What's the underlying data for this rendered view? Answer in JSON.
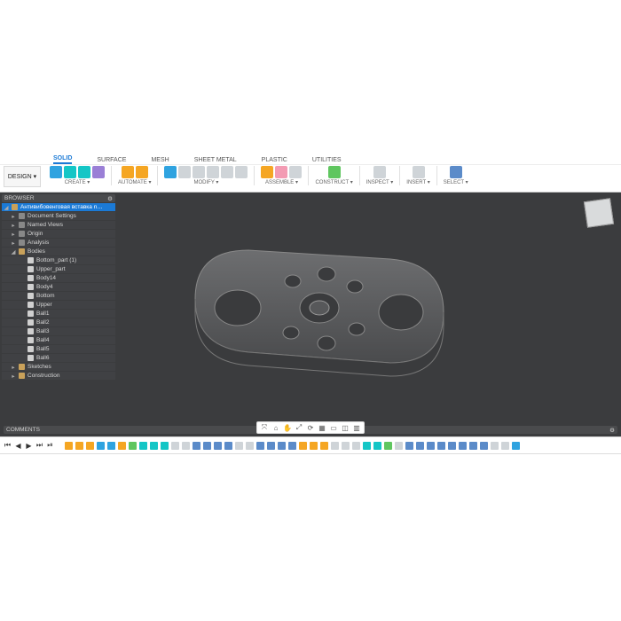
{
  "design_button": "DESIGN ▾",
  "tabs": [
    "SOLID",
    "SURFACE",
    "MESH",
    "SHEET METAL",
    "PLASTIC",
    "UTILITIES"
  ],
  "active_tab": "SOLID",
  "ribbon_groups": [
    {
      "label": "CREATE ▾",
      "icons": [
        "c-blue",
        "c-teal",
        "c-teal",
        "c-purp"
      ]
    },
    {
      "label": "AUTOMATE ▾",
      "icons": [
        "c-orange",
        "c-orange"
      ]
    },
    {
      "label": "MODIFY ▾",
      "icons": [
        "c-blue",
        "c-grey",
        "c-grey",
        "c-grey",
        "c-grey",
        "c-grey"
      ]
    },
    {
      "label": "ASSEMBLE ▾",
      "icons": [
        "c-orange",
        "c-pink",
        "c-grey"
      ]
    },
    {
      "label": "CONSTRUCT ▾",
      "icons": [
        "c-green"
      ]
    },
    {
      "label": "INSPECT ▾",
      "icons": [
        "c-grey"
      ]
    },
    {
      "label": "INSERT ▾",
      "icons": [
        "c-grey"
      ]
    },
    {
      "label": "SELECT ▾",
      "icons": [
        "c-nav"
      ]
    }
  ],
  "browser_title": "BROWSER",
  "tree": [
    {
      "d": 0,
      "tw": "◢",
      "label": "Антивибовенговая вставка n…",
      "sel": true,
      "i": "ic"
    },
    {
      "d": 1,
      "tw": "▸",
      "label": "Document Settings",
      "i": "g"
    },
    {
      "d": 1,
      "tw": "▸",
      "label": "Named Views",
      "i": "g"
    },
    {
      "d": 1,
      "tw": "▸",
      "label": "Origin",
      "i": "g"
    },
    {
      "d": 1,
      "tw": "▸",
      "label": "Analysis",
      "i": "g"
    },
    {
      "d": 1,
      "tw": "◢",
      "label": "Bodies",
      "i": "ic"
    },
    {
      "d": 2,
      "tw": "",
      "label": "Bottom_part (1)",
      "i": "b"
    },
    {
      "d": 2,
      "tw": "",
      "label": "Upper_part",
      "i": "b"
    },
    {
      "d": 2,
      "tw": "",
      "label": "Body14",
      "i": "b"
    },
    {
      "d": 2,
      "tw": "",
      "label": "Body4",
      "i": "b"
    },
    {
      "d": 2,
      "tw": "",
      "label": "Bottom",
      "i": "b"
    },
    {
      "d": 2,
      "tw": "",
      "label": "Upper",
      "i": "b"
    },
    {
      "d": 2,
      "tw": "",
      "label": "Ball1",
      "i": "b"
    },
    {
      "d": 2,
      "tw": "",
      "label": "Ball2",
      "i": "b"
    },
    {
      "d": 2,
      "tw": "",
      "label": "Ball3",
      "i": "b"
    },
    {
      "d": 2,
      "tw": "",
      "label": "Ball4",
      "i": "b"
    },
    {
      "d": 2,
      "tw": "",
      "label": "Ball5",
      "i": "b"
    },
    {
      "d": 2,
      "tw": "",
      "label": "Ball6",
      "i": "b"
    },
    {
      "d": 1,
      "tw": "▸",
      "label": "Sketches",
      "i": "ic"
    },
    {
      "d": 1,
      "tw": "▸",
      "label": "Construction",
      "i": "ic"
    }
  ],
  "comments": "COMMENTS",
  "viewbar": [
    "⤧",
    "⌂",
    "✋",
    "⤢",
    "⟳",
    "▦",
    "▭",
    "◫",
    "▥"
  ],
  "timeline": {
    "controls": [
      "⏮",
      "◀",
      "▶",
      "⏭",
      "⏯"
    ],
    "items": [
      "c-orange",
      "c-orange",
      "c-orange",
      "c-blue",
      "c-blue",
      "c-orange",
      "c-green",
      "c-teal",
      "c-teal",
      "c-teal",
      "c-grey",
      "c-grey",
      "c-nav",
      "c-nav",
      "c-nav",
      "c-nav",
      "c-grey",
      "c-grey",
      "c-nav",
      "c-nav",
      "c-nav",
      "c-nav",
      "c-orange",
      "c-orange",
      "c-orange",
      "c-grey",
      "c-grey",
      "c-grey",
      "c-teal",
      "c-teal",
      "c-green",
      "c-grey",
      "c-nav",
      "c-nav",
      "c-nav",
      "c-nav",
      "c-nav",
      "c-nav",
      "c-nav",
      "c-nav",
      "c-grey",
      "c-grey",
      "c-blue"
    ]
  }
}
